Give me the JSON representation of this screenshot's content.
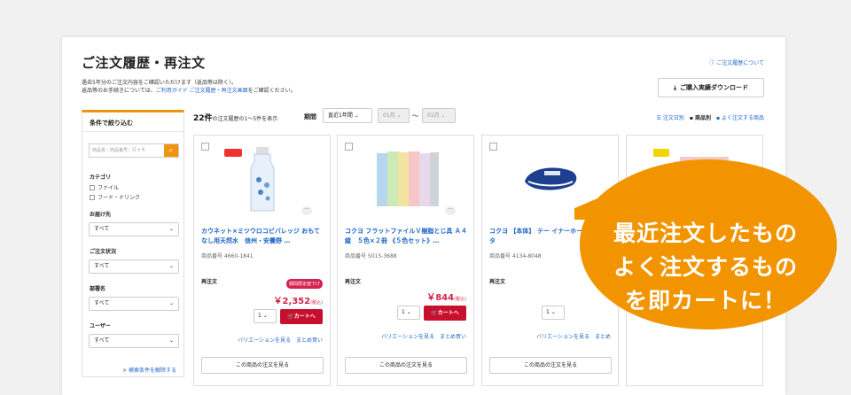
{
  "page": {
    "title": "ご注文履歴・再注文",
    "help_link": "ご注文履歴について",
    "desc_line1": "過去5年分のご注文内容をご確認いただけます（返品等は除く）。",
    "desc_line2_pre": "返品等のお手続きについては、",
    "desc_line2_link": "ご利用ガイド ご注文履歴・再注文画面",
    "desc_line2_post": "をご確認ください。",
    "download_label": "ご購入実績ダウンロード"
  },
  "filter": {
    "title": "条件で絞り込む",
    "search_placeholder": "商品名・商品番号・行メモ",
    "category_label": "カテゴリ",
    "categories": [
      "ファイル",
      "フード・ドリンク"
    ],
    "dest_label": "お届け先",
    "status_label": "ご注文状況",
    "dept_label": "部署名",
    "user_label": "ユーザー",
    "select_value": "すべて",
    "clear_label": "× 検索条件を解除する"
  },
  "toolbar": {
    "count": "22件",
    "count_suffix": "の注文履歴の1〜5件を表示",
    "period_label": "期間",
    "period_value": "直近1年間",
    "from_value": "01月",
    "tilde": "〜",
    "to_value": "01月",
    "view_by_order": "注文日別",
    "view_by_product": "商品別",
    "view_frequent": "よく注文する商品"
  },
  "cards": [
    {
      "name": "カウネット×ミツウロコビバレッジ おもてなし用天然水　信州・安曇野 …",
      "number": "商品番号 4660-1841",
      "reorder_label": "再注文",
      "badge": "期間限定値下げ",
      "price": "￥2,352",
      "tax": "(税込)",
      "qty": "1",
      "cart_label": "カートへ",
      "variation_label": "バリエーションを見る",
      "bulk_label": "まとめ買い",
      "see_orders_label": "この商品の注文を見る"
    },
    {
      "name": "コクヨ フラットファイルＶ樹脂とじ具 Ａ４縦　５色×２冊 《５色セット》…",
      "number": "商品番号 5015-3688",
      "reorder_label": "再注文",
      "price": "￥844",
      "tax": "(税込)",
      "qty": "1",
      "cart_label": "カートへ",
      "variation_label": "バリエーションを見る",
      "bulk_label": "まとめ買い",
      "see_orders_label": "この商品の注文を見る"
    },
    {
      "name": "コクヨ 【本体】 テー イナーホールド 詰替タ",
      "number": "商品番号 4134-8048",
      "reorder_label": "再注文",
      "price": "￥",
      "qty": "1",
      "cart_label": "カートへ",
      "variation_label": "バリエーションを見る",
      "bulk_label": "まとめ",
      "see_orders_label": "この商品の注文を見る"
    }
  ],
  "callout": {
    "line1": "最近注文したもの",
    "line2": "よく注文するもの",
    "line3": "を即カートに！",
    "color": "#f29400"
  },
  "colors": {
    "accent": "#f0930e",
    "link": "#1a64c8",
    "price": "#d3234e",
    "cart": "#c8102e"
  }
}
